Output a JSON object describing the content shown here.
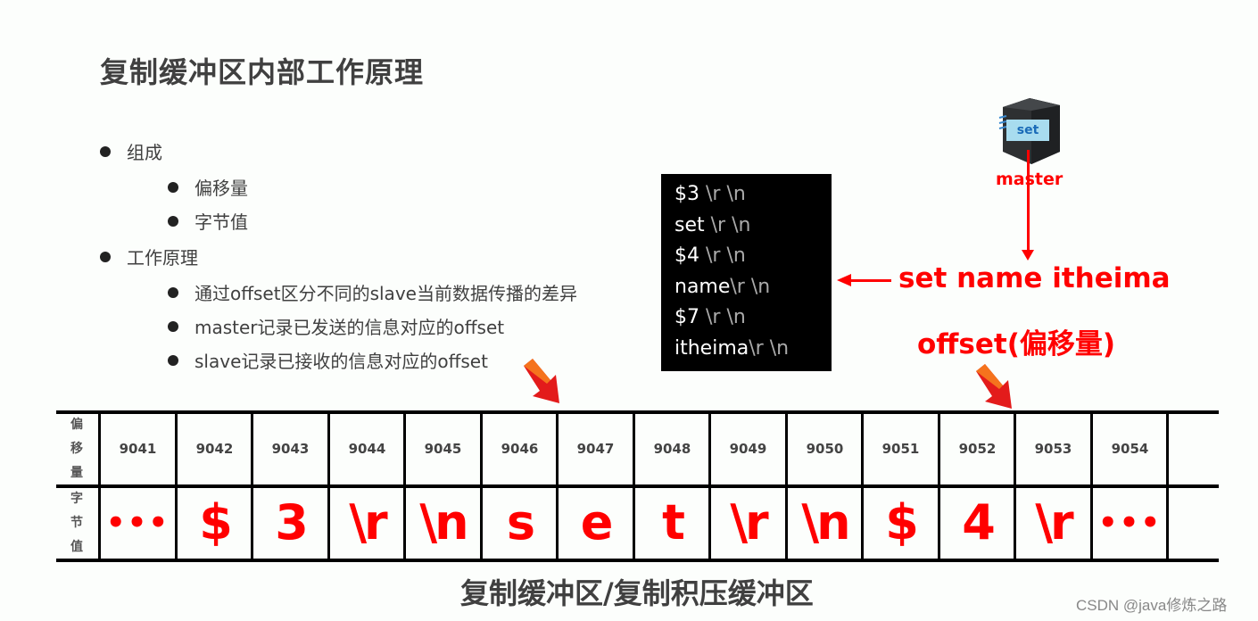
{
  "slide": {
    "title": "复制缓冲区内部工作原理",
    "bullets": [
      {
        "level": 1,
        "text": "组成"
      },
      {
        "level": 2,
        "text": "偏移量"
      },
      {
        "level": 2,
        "text": "字节值"
      },
      {
        "level": 1,
        "text": "工作原理"
      },
      {
        "level": 2,
        "text": "通过offset区分不同的slave当前数据传播的差异"
      },
      {
        "level": 2,
        "text": "master记录已发送的信息对应的offset"
      },
      {
        "level": 2,
        "text": "slave记录已接收的信息对应的offset"
      }
    ],
    "code_lines": [
      {
        "token": "$3",
        "suffix": "\\r \\n"
      },
      {
        "token": "set",
        "suffix": "\\r \\n"
      },
      {
        "token": "$4",
        "suffix": "\\r \\n"
      },
      {
        "token": "name",
        "suffix": "\\r \\n"
      },
      {
        "token": "$7",
        "suffix": "\\r \\n"
      },
      {
        "token": "itheima",
        "suffix": "\\r \\n"
      }
    ],
    "server": {
      "badge": "set",
      "label": "master"
    },
    "command": "set name itheima",
    "offset_label": "offset(偏移量)",
    "table": {
      "row_labels": {
        "offset": [
          "偏",
          "移",
          "量"
        ],
        "byte": [
          "字",
          "节",
          "值"
        ]
      },
      "offsets": [
        "9041",
        "9042",
        "9043",
        "9044",
        "9045",
        "9046",
        "9047",
        "9048",
        "9049",
        "9050",
        "9051",
        "9052",
        "9053",
        "9054",
        ""
      ],
      "bytes": [
        "•••",
        "$",
        "3",
        "\\r",
        "\\n",
        "s",
        "e",
        "t",
        "\\r",
        "\\n",
        "$",
        "4",
        "\\r",
        "•••",
        ""
      ]
    },
    "caption": "复制缓冲区/复制积压缓冲区",
    "watermark": "CSDN @java修炼之路",
    "colors": {
      "accent_red": "#ff0000",
      "text_dark": "#404040",
      "code_bg": "#000000"
    }
  }
}
